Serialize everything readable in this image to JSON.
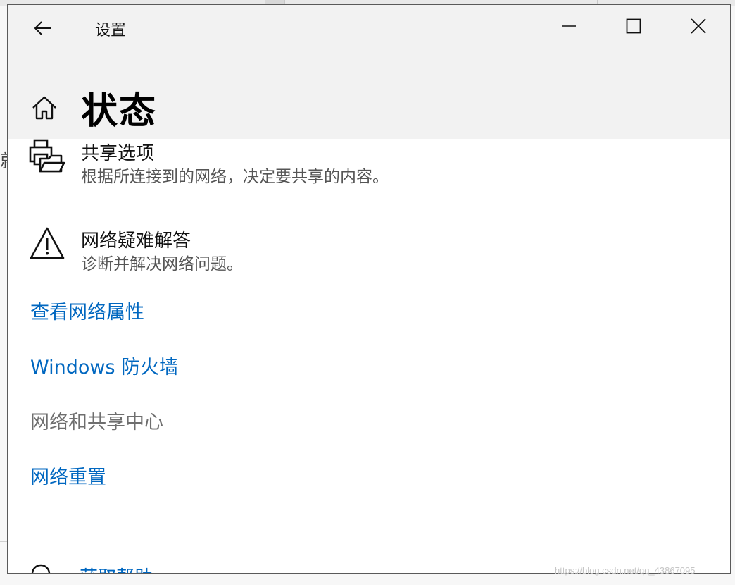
{
  "window": {
    "title": "设置",
    "page_title": "状态"
  },
  "items": [
    {
      "title": "共享选项",
      "subtitle": "根据所连接到的网络，决定要共享的内容。",
      "icon": "printer-folder-icon"
    },
    {
      "title": "网络疑难解答",
      "subtitle": "诊断并解决网络问题。",
      "icon": "warning-icon"
    }
  ],
  "links": [
    {
      "label": "查看网络属性",
      "enabled": true
    },
    {
      "label": "Windows 防火墙",
      "enabled": true
    },
    {
      "label": "网络和共享中心",
      "enabled": false
    },
    {
      "label": "网络重置",
      "enabled": true
    }
  ],
  "partial_item": {
    "label": "获取帮助",
    "icon": "help-chat-icon"
  },
  "background": {
    "edge_char": "就"
  },
  "watermark": "https://blog.csdn.net/qq_43867095",
  "colors": {
    "link": "#0067c0",
    "disabled_link": "#6e6e6e",
    "header_bg": "#f2f2f2"
  }
}
